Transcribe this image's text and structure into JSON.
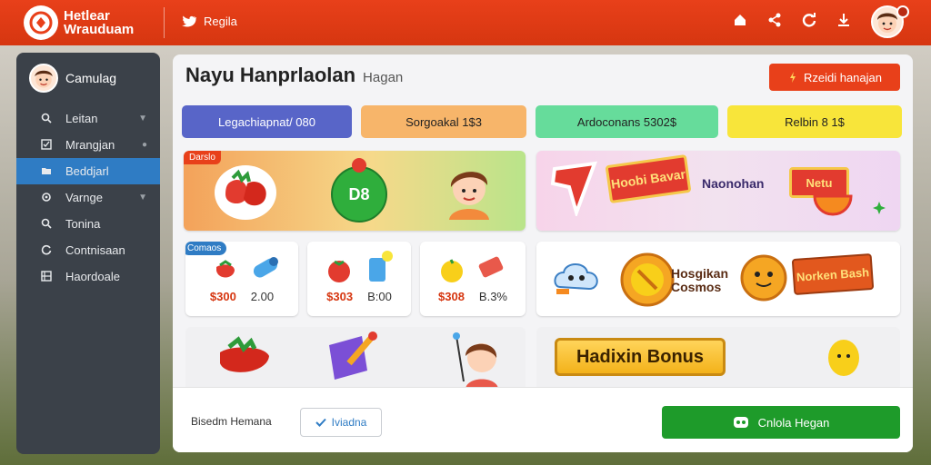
{
  "app": {
    "brand_line1": "Hetlear",
    "brand_line2": "Wrauduam",
    "twitter_label": "Regila"
  },
  "top_icons": [
    "home-icon",
    "share-icon",
    "refresh-icon",
    "download-icon"
  ],
  "sidebar": {
    "user_name": "Camulag",
    "items": [
      {
        "label": "Leitan",
        "icon": "search-icon",
        "chevron": "chevron-down-icon"
      },
      {
        "label": "Mrangjan",
        "icon": "checkbox-icon",
        "chevron": "dot-icon"
      },
      {
        "label": "Beddjarl",
        "icon": "folder-icon",
        "active": true
      },
      {
        "label": "Varnge",
        "icon": "location-icon",
        "chevron": "chevron-down-icon"
      },
      {
        "label": "Tonina",
        "icon": "search-icon"
      },
      {
        "label": "Contnisaan",
        "icon": "refresh-icon"
      },
      {
        "label": "Haordoale",
        "icon": "grid-icon"
      }
    ]
  },
  "main": {
    "title": "Nayu Hanprlaolan",
    "subtitle": "Hagan",
    "reward_button": "Rzeidi hanajan",
    "stats": [
      {
        "label": "Legachiapnat/ 080",
        "color": "#5865c8",
        "text_color": "#ffffff"
      },
      {
        "label": "Sorgoakal 1$3",
        "color": "#f7b56a",
        "text_color": "#222222"
      },
      {
        "label": "Ardoconans 5302$",
        "color": "#66dc9b",
        "text_color": "#222222"
      },
      {
        "label": "Relbin 8 1$",
        "color": "#f8e53a",
        "text_color": "#222222"
      }
    ],
    "promo_tag": "Darslo",
    "promo_badge": "D8",
    "stickers_banner": [
      "Hoobi Bavar",
      "Naonohan",
      "Netu"
    ],
    "shop_tag": "Comaos",
    "shop_items": [
      {
        "price": "$300",
        "amount": "2.00"
      },
      {
        "price": "$303",
        "amount": "B:00"
      },
      {
        "price": "$308",
        "amount": "B.3%"
      }
    ],
    "mascot_banner": [
      "Hosgikan Cosmos",
      "Norken Bash"
    ],
    "bonus_label": "Hadixin Bonus"
  },
  "footer": {
    "label": "Bisedm Hemana",
    "check_label": "Iviadna",
    "cta_label": "Cnlola Hegan"
  },
  "colors": {
    "brand": "#e8401a",
    "sidebar": "#3b4149",
    "active": "#2f7cc4",
    "cta": "#1e9b2a"
  }
}
